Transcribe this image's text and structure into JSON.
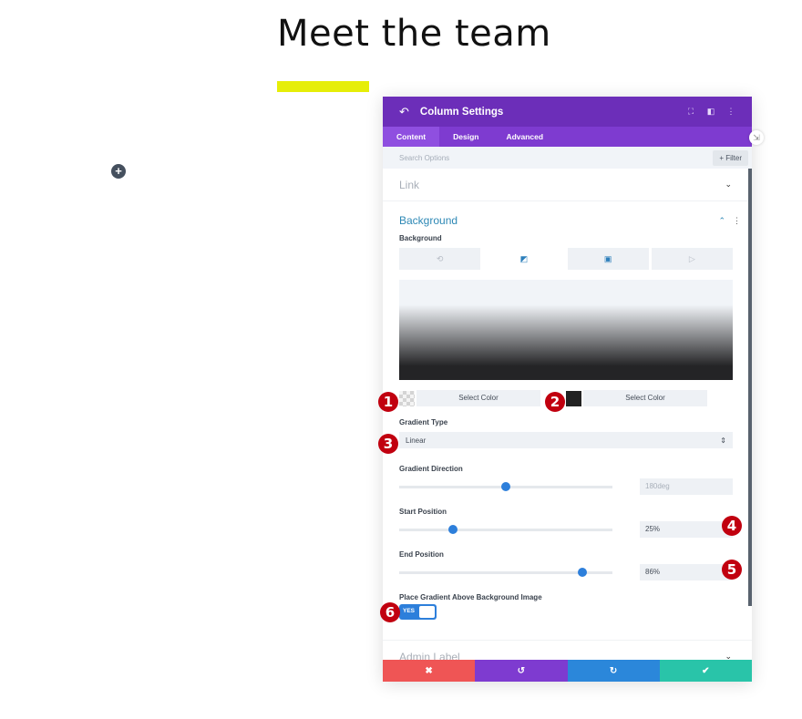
{
  "page": {
    "title": "Meet the team",
    "accent_underline_color": "#e6ee08",
    "add_button_icon": "+"
  },
  "modal": {
    "header": {
      "back_icon": "↶",
      "title": "Column Settings",
      "icons": [
        "⛶",
        "◧",
        "⋮"
      ]
    },
    "tabs": [
      {
        "label": "Content",
        "active": true
      },
      {
        "label": "Design",
        "active": false
      },
      {
        "label": "Advanced",
        "active": false
      }
    ],
    "search": {
      "placeholder": "Search Options",
      "filter_label": "+ Filter"
    },
    "link_section": {
      "label": "Link",
      "chevron": "⌄"
    },
    "background_section": {
      "label": "Background",
      "collapse_icon": "⌃",
      "menu_icon": "⋮",
      "field_label": "Background",
      "bg_tabs": [
        "⟲",
        "◩",
        "▣",
        "▷"
      ],
      "color1": {
        "label": "Select Color",
        "swatch": "transparent"
      },
      "color2": {
        "label": "Select Color",
        "swatch": "#222222"
      },
      "gradient_type": {
        "label": "Gradient Type",
        "value": "Linear",
        "arrow": "⇕"
      },
      "gradient_direction": {
        "label": "Gradient Direction",
        "value": "180deg",
        "fraction": 0.5
      },
      "start_position": {
        "label": "Start Position",
        "value": "25%",
        "fraction": 0.25
      },
      "end_position": {
        "label": "End Position",
        "value": "86%",
        "fraction": 0.86
      },
      "place_gradient": {
        "label": "Place Gradient Above Background Image",
        "toggle_label": "YES",
        "on": true
      }
    },
    "admin_section": {
      "label": "Admin Label",
      "chevron": "⌄"
    },
    "footer": {
      "close": "✖",
      "undo": "↺",
      "redo": "↻",
      "save": "✔"
    }
  },
  "badges": [
    "1",
    "2",
    "3",
    "4",
    "5",
    "6"
  ]
}
